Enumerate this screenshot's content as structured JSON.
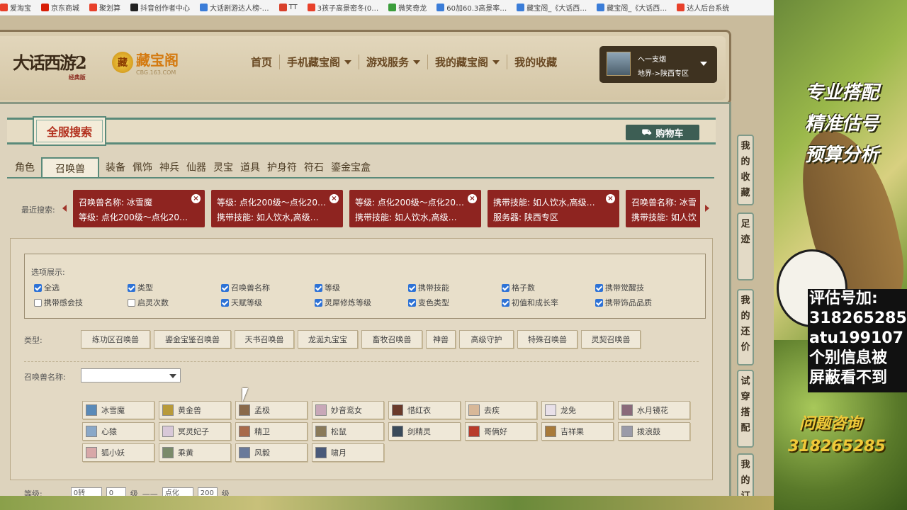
{
  "bookmarks": [
    {
      "label": "爱淘宝",
      "color": "#e8402a"
    },
    {
      "label": "京东商城",
      "color": "#d81e06"
    },
    {
      "label": "聚划算",
      "color": "#e8402a"
    },
    {
      "label": "抖音创作者中心",
      "color": "#222222"
    },
    {
      "label": "大话剧游达人榜-…",
      "color": "#3b7dd8"
    },
    {
      "label": "TT",
      "color": "#d8402a"
    },
    {
      "label": "3孩子高景密冬(0…",
      "color": "#e8402a"
    },
    {
      "label": "微笑奇龙",
      "color": "#3b9d3b"
    },
    {
      "label": "60加60.3高景率…",
      "color": "#3b7dd8"
    },
    {
      "label": "藏宝阁_《大话西…",
      "color": "#3b7dd8"
    },
    {
      "label": "藏宝阁_《大话西…",
      "color": "#3b7dd8"
    },
    {
      "label": "达人后台系统",
      "color": "#e8402a"
    }
  ],
  "header": {
    "game_logo": "大话西游2",
    "game_logo_sub": "经典版",
    "cbg_logo": "藏宝阁",
    "cbg_coin": "藏",
    "cbg_domain": "CBG.163.COM",
    "nav": [
      {
        "label": "首页",
        "dropdown": false
      },
      {
        "label": "手机藏宝阁",
        "dropdown": true
      },
      {
        "label": "游戏服务",
        "dropdown": true
      },
      {
        "label": "我的藏宝阁",
        "dropdown": true
      },
      {
        "label": "我的收藏",
        "dropdown": false
      }
    ],
    "user": {
      "name": "へ一支烟",
      "server": "地界->陕西专区"
    }
  },
  "panel": {
    "title": "全服搜索",
    "cart_label": "购物车",
    "categories": [
      "角色",
      "召唤兽",
      "装备",
      "佩饰",
      "神兵",
      "仙器",
      "灵宝",
      "道具",
      "护身符",
      "符石",
      "鎏金宝盒"
    ],
    "active_category": "召唤兽"
  },
  "recent": {
    "label": "最近搜索:",
    "cards": [
      {
        "line1": "召唤兽名称: 冰雪魔",
        "line2": "等级: 点化200级～点化20…"
      },
      {
        "line1": "等级: 点化200级～点化20…",
        "line2": "携带技能: 如人饮水,高级…"
      },
      {
        "line1": "等级: 点化200级～点化20…",
        "line2": "携带技能: 如人饮水,高级…"
      },
      {
        "line1": "携带技能: 如人饮水,高级…",
        "line2": "服务器: 陕西专区"
      },
      {
        "line1": "召唤兽名称: 冰雪",
        "line2": "携带技能: 如人饮"
      }
    ]
  },
  "options": {
    "title": "选项展示:",
    "items": [
      {
        "label": "全选",
        "checked": true
      },
      {
        "label": "类型",
        "checked": true
      },
      {
        "label": "召唤兽名称",
        "checked": true
      },
      {
        "label": "等级",
        "checked": true
      },
      {
        "label": "携带技能",
        "checked": true
      },
      {
        "label": "格子数",
        "checked": true
      },
      {
        "label": "携带觉醒技",
        "checked": true
      },
      {
        "label": "携带感会技",
        "checked": false
      },
      {
        "label": "启灵次数",
        "checked": false
      },
      {
        "label": "天赋等级",
        "checked": true
      },
      {
        "label": "灵犀修炼等级",
        "checked": true
      },
      {
        "label": "变色类型",
        "checked": true
      },
      {
        "label": "初值和成长率",
        "checked": true
      },
      {
        "label": "携带饰品品质",
        "checked": true
      }
    ]
  },
  "type_filter": {
    "label": "类型:",
    "buttons": [
      "练功区召唤兽",
      "鎏金宝鉴召唤兽",
      "天书召唤兽",
      "龙涎丸宝宝",
      "畜牧召唤兽",
      "神兽",
      "高级守护",
      "特殊召唤兽",
      "灵契召唤兽"
    ]
  },
  "name_filter": {
    "label": "召唤兽名称:",
    "selected": "",
    "pets": [
      {
        "name": "冰雪魔",
        "color": "#5a8ab8"
      },
      {
        "name": "黄金兽",
        "color": "#b89a3a"
      },
      {
        "name": "孟极",
        "color": "#8a6a4a"
      },
      {
        "name": "妙音鸾女",
        "color": "#c8a8b8"
      },
      {
        "name": "惜红衣",
        "color": "#6a3a2a"
      },
      {
        "name": "去疾",
        "color": "#d8b898"
      },
      {
        "name": "龙免",
        "color": "#e8e0e8"
      },
      {
        "name": "水月镜花",
        "color": "#8a6a7a"
      },
      {
        "name": "心猿",
        "color": "#8aa8c8"
      },
      {
        "name": "冥灵妃子",
        "color": "#d8c8d8"
      },
      {
        "name": "精卫",
        "color": "#a86a4a"
      },
      {
        "name": "松鼠",
        "color": "#8a7a5a"
      },
      {
        "name": "剑精灵",
        "color": "#3a4a5a"
      },
      {
        "name": "哥俩好",
        "color": "#b83a2a"
      },
      {
        "name": "吉祥果",
        "color": "#a87a3a"
      },
      {
        "name": "拨浪鼓",
        "color": "#9a9aa8"
      },
      {
        "name": "狐小妖",
        "color": "#d8a8a8"
      },
      {
        "name": "乘黄",
        "color": "#7a8a6a"
      },
      {
        "name": "风毅",
        "color": "#6a7a9a"
      },
      {
        "name": "啸月",
        "color": "#4a5a7a"
      }
    ]
  },
  "level_filter": {
    "label": "等级:",
    "from_rebirth": "0转",
    "from_level": "0",
    "unit": "级",
    "dash": "——",
    "to_rebirth": "点化",
    "to_level": "200"
  },
  "side_tabs": [
    "我的收藏",
    "足迹",
    "我的还价",
    "试穿搭配",
    "我的订"
  ],
  "banner": {
    "slogans": [
      "专业搭配",
      "精准估号",
      "预算分析"
    ],
    "contact": [
      "评估号加:",
      "318265285",
      "atu199107",
      "个别信息被",
      "屏蔽看不到"
    ],
    "qa_title": "问题咨询",
    "qa_number": "318265285"
  }
}
